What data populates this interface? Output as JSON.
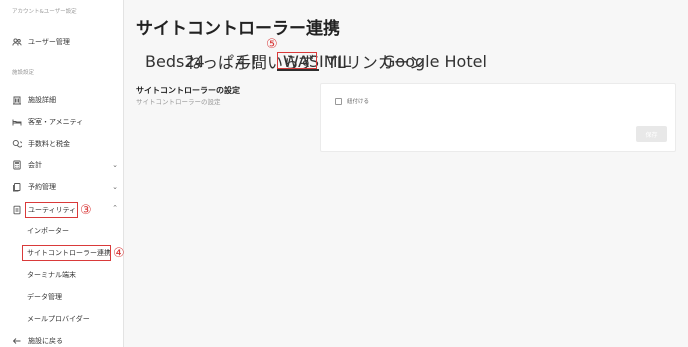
{
  "sidebar": {
    "section_account": "アカウント&ユーザー設定",
    "user_management": "ユーザー管理",
    "section_facility": "施設設定",
    "items": [
      {
        "label": "施設詳細"
      },
      {
        "label": "客室・アメニティ"
      },
      {
        "label": "手数料と税金"
      },
      {
        "label": "会計"
      },
      {
        "label": "予約管理"
      },
      {
        "label": "ユーティリティ"
      }
    ],
    "sub_items": [
      {
        "label": "インポーター"
      },
      {
        "label": "サイトコントローラー連携"
      },
      {
        "label": "ターミナル端末"
      },
      {
        "label": "データ管理"
      },
      {
        "label": "メールプロバイダー"
      }
    ],
    "back_label": "施設に戻る"
  },
  "annotations": {
    "n3": "③",
    "n4": "④",
    "n5": "⑤"
  },
  "main": {
    "title": "サイトコントローラー連携",
    "tabs": [
      {
        "label": "Beds24"
      },
      {
        "label": "ねっぱん！"
      },
      {
        "label": "手間いらず"
      },
      {
        "label": "WASIMIL"
      },
      {
        "label": "TLリンカーン"
      },
      {
        "label": "Google Hotel"
      }
    ],
    "active_tab": "WASIMIL",
    "settings_title": "サイトコントローラーの設定",
    "settings_subtitle": "サイトコントローラーの設定",
    "checkbox_label": "紐付ける",
    "save_label": "保存"
  },
  "colors": {
    "annotation": "#d93a3a",
    "tab_underline": "#2f2f2f"
  }
}
